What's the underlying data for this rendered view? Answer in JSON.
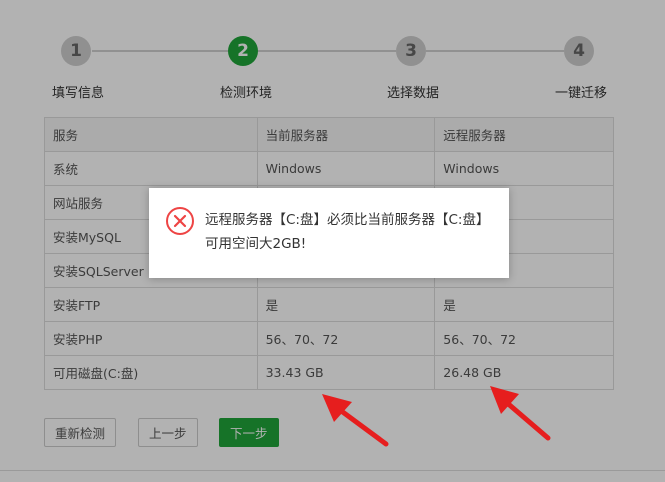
{
  "steps": [
    {
      "number": "1",
      "label": "填写信息"
    },
    {
      "number": "2",
      "label": "检测环境"
    },
    {
      "number": "3",
      "label": "选择数据"
    },
    {
      "number": "4",
      "label": "一键迁移"
    }
  ],
  "table": {
    "headers": [
      "服务",
      "当前服务器",
      "远程服务器"
    ],
    "rows": [
      [
        "系统",
        "Windows",
        "Windows"
      ],
      [
        "网站服务",
        "",
        ""
      ],
      [
        "安装MySQL",
        "",
        ""
      ],
      [
        "安装SQLServer",
        "",
        ""
      ],
      [
        "安装FTP",
        "是",
        "是"
      ],
      [
        "安装PHP",
        "56、70、72",
        "56、70、72"
      ],
      [
        "可用磁盘(C:盘)",
        "33.43 GB",
        "26.48 GB"
      ]
    ]
  },
  "buttons": {
    "recheck": "重新检测",
    "prev": "上一步",
    "next": "下一步"
  },
  "dialog": {
    "icon": "error-circle-icon",
    "message": "远程服务器【C:盘】必须比当前服务器【C:盘】可用空间大2GB!"
  },
  "colors": {
    "accent": "#20a53a",
    "error": "#e44",
    "annotation_arrow": "#e61e1e"
  }
}
